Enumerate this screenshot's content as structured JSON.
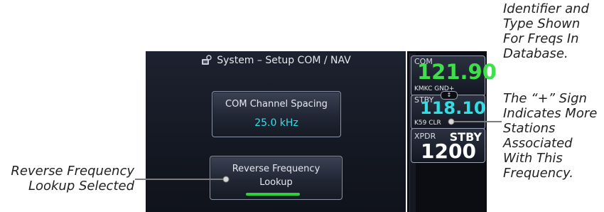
{
  "header": {
    "title": "System – Setup COM / NAV"
  },
  "buttons": {
    "com_spacing": {
      "label": "COM Channel Spacing",
      "value": "25.0 kHz"
    },
    "reverse_lookup": {
      "label_line1": "Reverse Frequency",
      "label_line2": "Lookup",
      "indicator_color": "#2fd13a"
    }
  },
  "radio_strip": {
    "com": {
      "tag": "COM",
      "frequency": "121.90",
      "station": "KMKC GND+"
    },
    "stby": {
      "tag": "STBY",
      "frequency": "118.10",
      "station": "K59 CLR"
    },
    "transfer_symbol": "↕",
    "xpdr": {
      "tag": "XPDR",
      "mode": "STBY",
      "code": "1200"
    }
  },
  "callouts": {
    "identifier": "Identifier and Type Shown For Freqs In Database.",
    "plus_sign": "The “+” Sign Indicates More Stations Associated With This Frequency.",
    "reverse": "Reverse Frequency Lookup Selected"
  },
  "colors": {
    "com_active": "#3ee04a",
    "stby": "#2ee0e6",
    "spacing_value": "#2ee0e6"
  }
}
